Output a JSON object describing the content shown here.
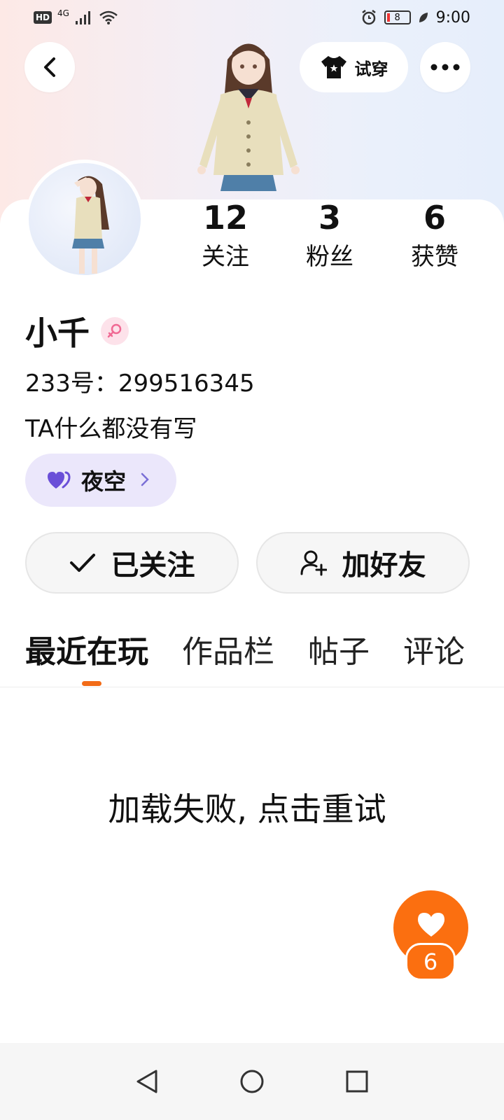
{
  "status_bar": {
    "network": "HD",
    "signal": "4G",
    "battery": "8",
    "time": "9:00"
  },
  "header": {
    "tryon_label": "试穿"
  },
  "stats": [
    {
      "value": "12",
      "label": "关注"
    },
    {
      "value": "3",
      "label": "粉丝"
    },
    {
      "value": "6",
      "label": "获赞"
    }
  ],
  "profile": {
    "name": "小千",
    "id_line": "233号：299516345",
    "bio": "TA什么都没有写",
    "tag": "夜空"
  },
  "actions": {
    "followed_label": "已关注",
    "add_friend_label": "加好友"
  },
  "tabs": [
    "最近在玩",
    "作品栏",
    "帖子",
    "评论"
  ],
  "main": {
    "load_failed": "加载失败, 点击重试"
  },
  "like_fab": {
    "count": "6"
  },
  "colors": {
    "accent": "#fb6f10",
    "tag_bg": "#ebe7fb",
    "tag_icon": "#7a6fd6",
    "gender_badge": "#fde2ea"
  }
}
